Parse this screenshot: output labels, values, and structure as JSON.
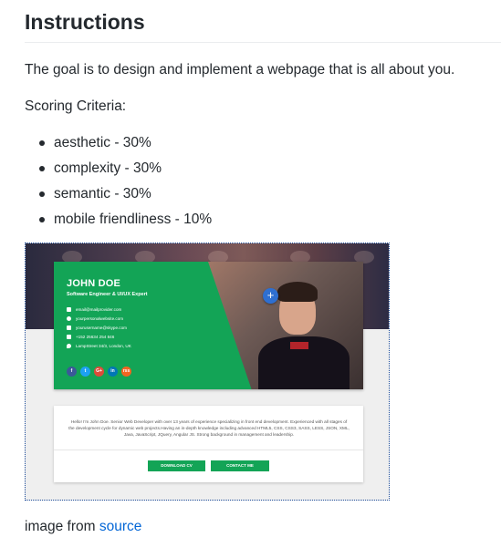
{
  "doc": {
    "heading": "Instructions",
    "goal": "The goal is to design and implement a webpage that is all about you.",
    "criteria_label": "Scoring Criteria:",
    "criteria": [
      "aesthetic - 30%",
      "complexity - 30%",
      "semantic - 30%",
      "mobile friendliness - 10%"
    ],
    "caption_prefix": "image from ",
    "caption_link": "source"
  },
  "image": {
    "name": "JOHN DOE",
    "role": "Software Engineer & UI/UX Expert",
    "contacts": [
      "email@mailprovider.com",
      "yourpersonalwebsite.com",
      "yourusername@skype.com",
      "+152 25634 254 846",
      "LampStreet 34/3, London, UK"
    ],
    "socials": [
      {
        "label": "f",
        "color": "#3b5998"
      },
      {
        "label": "t",
        "color": "#1da1f2"
      },
      {
        "label": "G+",
        "color": "#dd4b39"
      },
      {
        "label": "in",
        "color": "#0077b5"
      },
      {
        "label": "rss",
        "color": "#f26522"
      }
    ],
    "plus": "+",
    "about": "Hello! I'm John Doe. Senior Web Developer with over 13 years of experience specializing in front end development. Experienced with all stages of the development cycle for dynamic web projects.Having an in-depth knowledge including advanced HTML5, CSS, CSS3, SASS, LESS, JSON, XML, Java, JavaScript, JQuery, Angular JS. Strong background in management and leadership.",
    "download_label": "DOWNLOAD CV",
    "contact_label": "CONTACT ME"
  },
  "colors": {
    "accent": "#13a456",
    "link": "#0366d6"
  }
}
